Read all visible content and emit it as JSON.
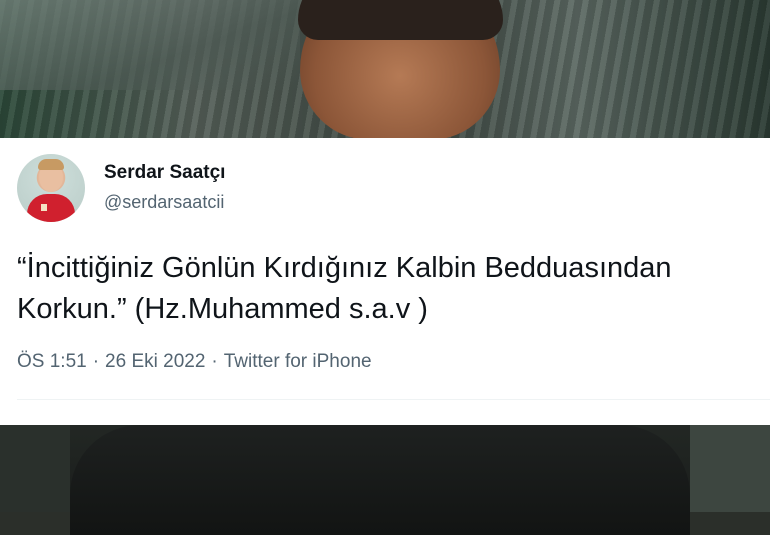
{
  "tweet": {
    "author_name": "Serdar Saatçı",
    "author_handle": "@serdarsaatcii",
    "text": "“İncittiğiniz Gönlün Kırdığınız Kalbin Bedduasından Korkun.” (Hz.Muhammed s.a.v )",
    "time": "ÖS 1:51",
    "date": "26 Eki 2022",
    "source": "Twitter for iPhone",
    "separator": "·"
  },
  "colors": {
    "card_bg": "#ffffff",
    "primary_text": "#0f1419",
    "secondary_text": "#536471"
  }
}
